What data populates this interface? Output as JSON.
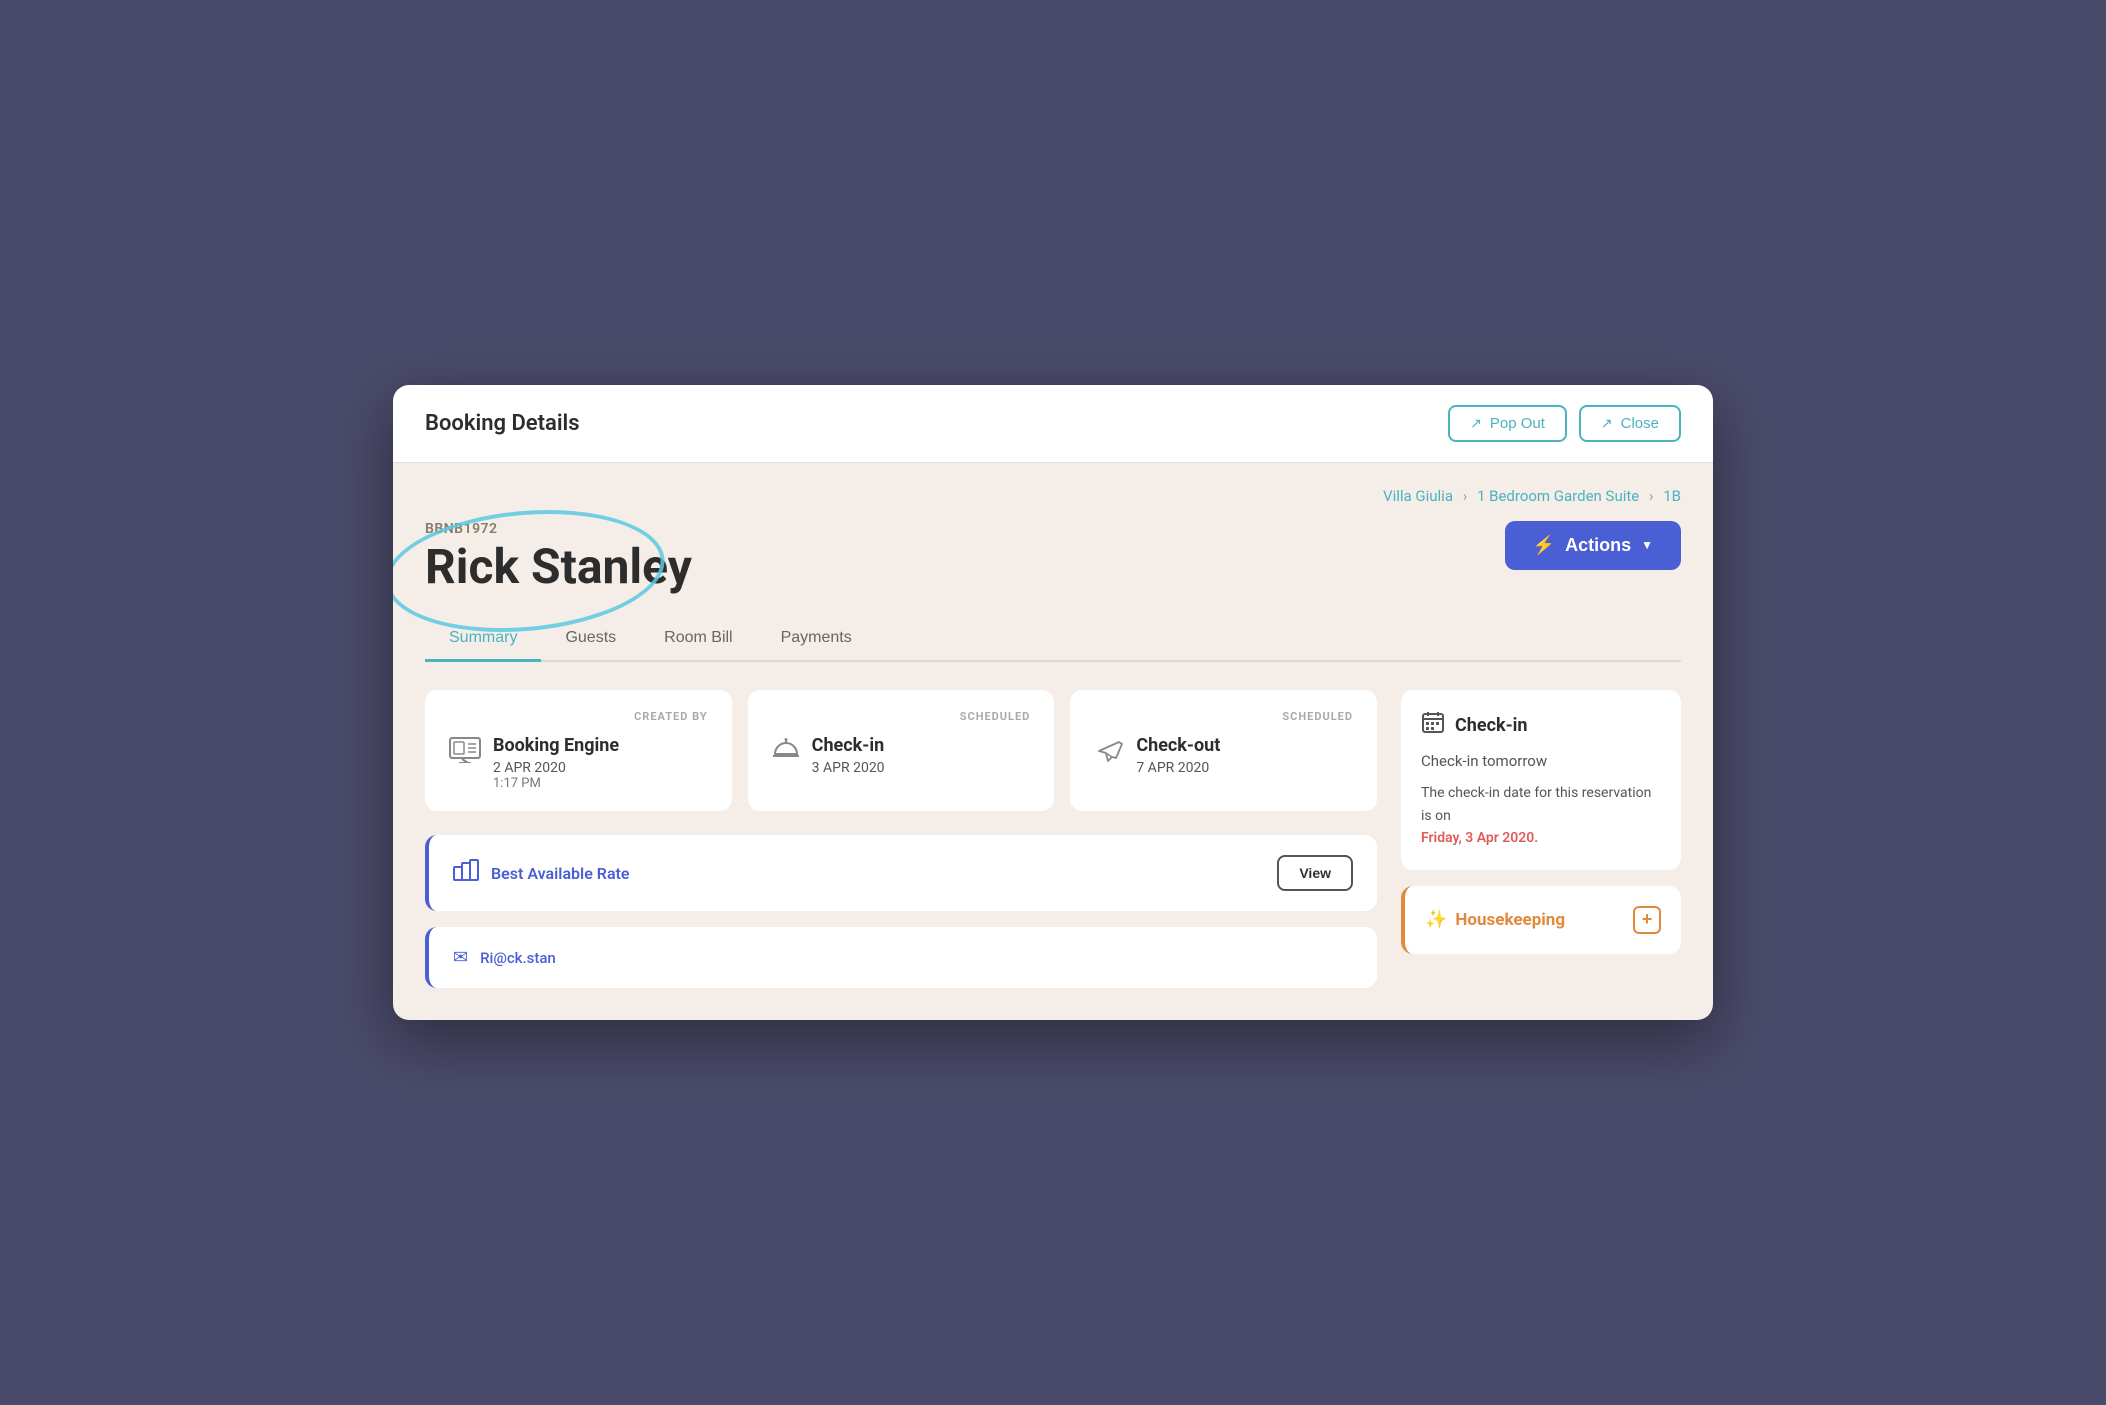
{
  "modal": {
    "title": "Booking Details",
    "pop_out_label": "Pop Out",
    "close_label": "Close"
  },
  "breadcrumb": {
    "property": "Villa Giulia",
    "room_type": "1 Bedroom Garden Suite",
    "room_number": "1B"
  },
  "booking": {
    "reference": "BBNB1972",
    "guest_name": "Rick Stanley",
    "actions_label": "Actions"
  },
  "tabs": [
    {
      "label": "Summary",
      "active": true
    },
    {
      "label": "Guests",
      "active": false
    },
    {
      "label": "Room Bill",
      "active": false
    },
    {
      "label": "Payments",
      "active": false
    }
  ],
  "cards": {
    "created": {
      "label": "CREATED BY",
      "title": "Booking Engine",
      "date": "2 APR 2020",
      "time": "1:17 PM"
    },
    "checkin": {
      "label": "SCHEDULED",
      "title": "Check-in",
      "date": "3 APR 2020"
    },
    "checkout": {
      "label": "SCHEDULED",
      "title": "Check-out",
      "date": "7 APR 2020"
    }
  },
  "rate": {
    "title": "Best Available Rate",
    "view_label": "View"
  },
  "email": {
    "address": "Ri@ck.stan"
  },
  "sidebar": {
    "checkin_panel": {
      "title": "Check-in",
      "subtitle": "Check-in tomorrow",
      "body_text": "The check-in date for this reservation is on",
      "highlight_date": "Friday, 3 Apr 2020."
    },
    "housekeeping": {
      "title": "Housekeeping"
    }
  }
}
